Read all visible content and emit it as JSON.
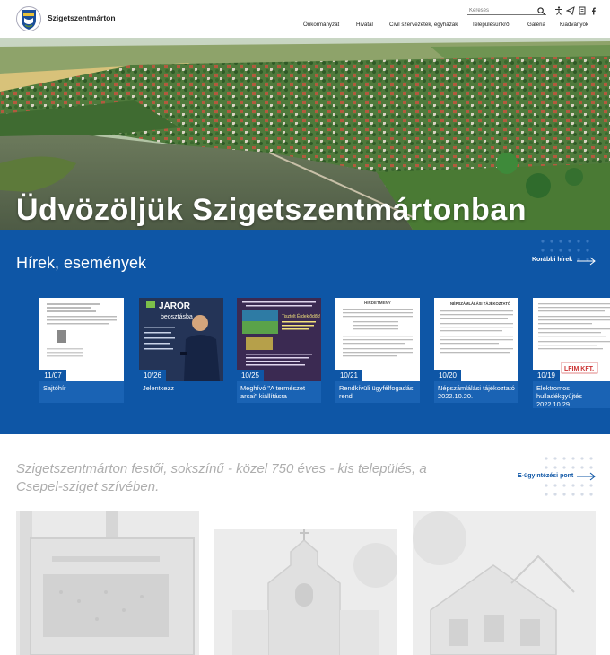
{
  "header": {
    "site_name": "Szigetszentmárton",
    "search_placeholder": "Keresés",
    "nav": [
      {
        "label": "Önkormányzat"
      },
      {
        "label": "Hivatal"
      },
      {
        "label": "Civil szervezetek, egyházak"
      },
      {
        "label": "Településünkről"
      },
      {
        "label": "Galéria"
      },
      {
        "label": "Kiadványok"
      }
    ]
  },
  "hero": {
    "title": "Üdvözöljük Szigetszentmártonban"
  },
  "news": {
    "title": "Hírek, események",
    "more_label": "Korábbi hírek",
    "items": [
      {
        "date": "11/07",
        "caption": "Sajtóhír"
      },
      {
        "date": "10/26",
        "caption": "Jelentkezz"
      },
      {
        "date": "10/25",
        "caption": "Meghívó \"A természet arcai\" kiállításra"
      },
      {
        "date": "10/21",
        "caption": "Rendkívüli ügyfélfogadási rend"
      },
      {
        "date": "10/20",
        "caption": "Népszámlálási tájékoztató 2022.10.20."
      },
      {
        "date": "10/19",
        "caption": "Elektromos hulladékgyűjtés 2022.10.29."
      }
    ],
    "thumb_texts": {
      "jaror_title": "JÁRŐR",
      "jaror_sub": "beosztásba",
      "flyer_line": "Tisztelt Érdeklődők!",
      "census_head": "NÉPSZÁMLÁLÁSI TÁJÉKOZTATÓ",
      "announce_head": "HIRDETMÉNY",
      "lfim": "LFIM KFT."
    }
  },
  "intro": {
    "tagline": "Szigetszentmárton festői, sokszínű - közel 750 éves - kis település, a Csepel-sziget szívében.",
    "eservice_label": "E-ügyintézési pont"
  },
  "colors": {
    "brand_blue": "#0e56a6",
    "white": "#ffffff"
  }
}
